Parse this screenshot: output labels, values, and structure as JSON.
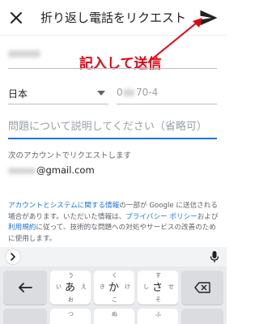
{
  "header": {
    "title": "折り返し電話をリクエスト",
    "close_icon": "close-icon",
    "send_icon": "send-icon"
  },
  "annotation": {
    "text": "記入して送信",
    "color": "#e60012"
  },
  "form": {
    "country": "日本",
    "phone_visible": "0",
    "phone_visible_tail": "70-4",
    "description_placeholder": "問題について説明してください（省略可）",
    "account_label": "次のアカウントでリクエストします",
    "email_domain": "@gmail.com"
  },
  "disclaimer": {
    "link1": "アカウントとシステムに関する情報",
    "text1": "の一部が Google に送信される場合があります。いただいた情報は、",
    "link2": "プライバシー ポリシー",
    "text2": "および",
    "link3": "利用規約",
    "text3": "に従って、技術的な問題への対処やサービスの改善のために使用します。"
  },
  "keyboard": {
    "keys": [
      {
        "main": "あ",
        "top": "う",
        "left": "い",
        "right": "え",
        "bottom": "お"
      },
      {
        "main": "か",
        "top": "く",
        "left": "き",
        "right": "け",
        "bottom": "こ"
      },
      {
        "main": "さ",
        "top": "す",
        "left": "し",
        "right": "せ",
        "bottom": "そ"
      }
    ],
    "row2_hints": [
      "つ",
      "ぬ",
      "ふ"
    ],
    "expand_icon": "chevron-right-icon",
    "mic_icon": "mic-icon",
    "backspace_icon": "backspace-icon",
    "left_arrow_icon": "left-arrow-icon"
  },
  "colors": {
    "accent": "#1a73e8",
    "annotation": "#e60012",
    "text": "#202124",
    "secondary_text": "#5f6368"
  }
}
